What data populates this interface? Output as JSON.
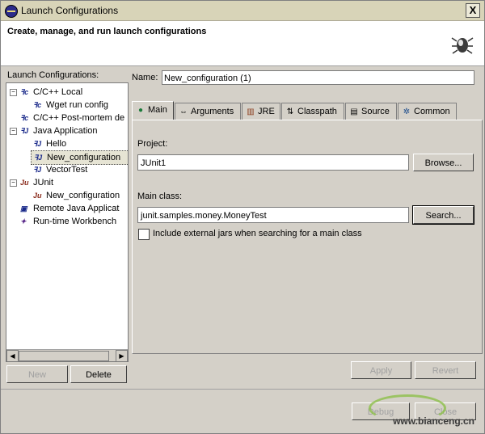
{
  "window": {
    "title": "Launch Configurations",
    "close_label": "X"
  },
  "header": {
    "message": "Create, manage, and run launch configurations"
  },
  "left": {
    "label": "Launch Configurations:",
    "tree": [
      {
        "label": "C/C++ Local",
        "icon": "c",
        "expander": "-"
      },
      {
        "label": "Wget run config",
        "icon": "c"
      },
      {
        "label": "C/C++ Post-mortem de",
        "icon": "c"
      },
      {
        "label": "Java Application",
        "icon": "J",
        "expander": "-"
      },
      {
        "label": "Hello",
        "icon": "J"
      },
      {
        "label": "New_configuration",
        "icon": "J"
      },
      {
        "label": "VectorTest",
        "icon": "J"
      },
      {
        "label": "JUnit",
        "icon": "Ju",
        "expander": "-"
      },
      {
        "label": "New_configuration",
        "icon": "Ju"
      },
      {
        "label": "Remote Java Applicat",
        "icon": "r"
      },
      {
        "label": "Run-time Workbench",
        "icon": "w"
      }
    ],
    "new_button": "New",
    "delete_button": "Delete"
  },
  "name_field": {
    "label": "Name:",
    "value": "New_configuration (1)"
  },
  "tabs": [
    {
      "label": "Main",
      "icon": "main-icon"
    },
    {
      "label": "Arguments",
      "icon": "arguments-icon"
    },
    {
      "label": "JRE",
      "icon": "jre-icon"
    },
    {
      "label": "Classpath",
      "icon": "classpath-icon"
    },
    {
      "label": "Source",
      "icon": "source-icon"
    },
    {
      "label": "Common",
      "icon": "common-icon"
    }
  ],
  "main_tab": {
    "project_label": "Project:",
    "project_value": "JUnit1",
    "browse_button": "Browse...",
    "main_class_label": "Main class:",
    "main_class_value": "junit.samples.money.MoneyTest",
    "search_button": "Search...",
    "include_external_label": "Include external jars when searching for a main class"
  },
  "buttons": {
    "apply": "Apply",
    "revert": "Revert",
    "debug": "Debug",
    "close": "Close"
  },
  "watermark": "www.bianceng.cn"
}
